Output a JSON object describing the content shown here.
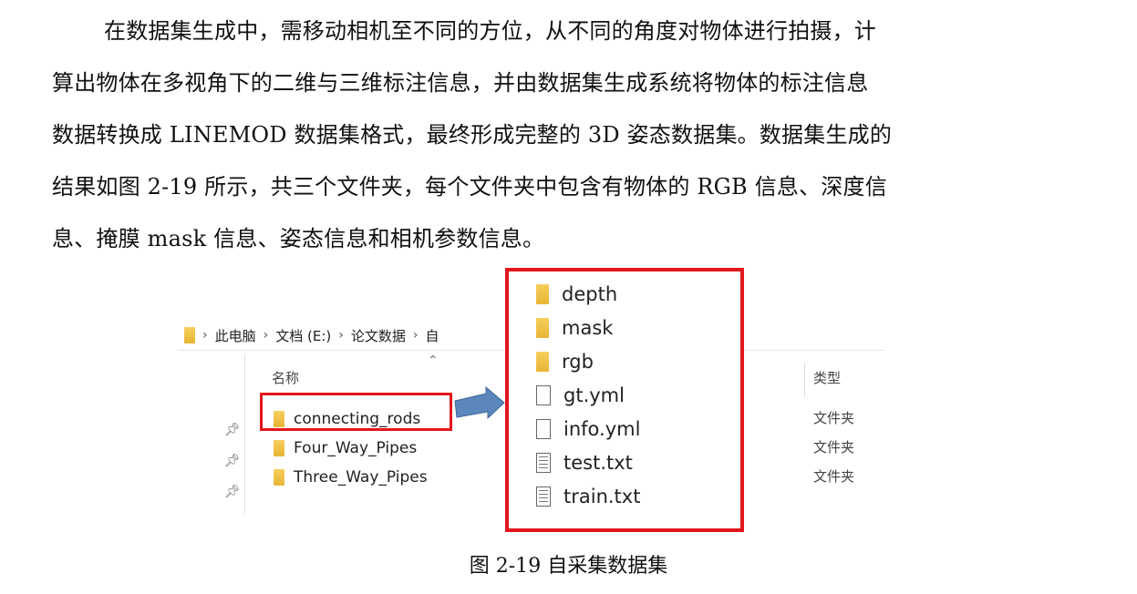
{
  "paragraph": [
    "在数据集生成中，需移动相机至不同的方位，从不同的角度对物体进行拍摄，计",
    "算出物体在多视角下的二维与三维标注信息，并由数据集生成系统将物体的标注信息",
    "数据转换成 LINEMOD 数据集格式，最终形成完整的 3D 姿态数据集。数据集生成的",
    "结果如图 2-19 所示，共三个文件夹，每个文件夹中包含有物体的 RGB 信息、深度信",
    "息、掩膜 mask 信息、姿态信息和相机参数信息。"
  ],
  "explorer": {
    "breadcrumb": [
      "此电脑",
      "文档 (E:)",
      "论文数据",
      "自"
    ],
    "column_name": "名称",
    "column_type": "类型",
    "rows": [
      {
        "name": "connecting_rods",
        "type": "文件夹"
      },
      {
        "name": "Four_Way_Pipes",
        "type": "文件夹"
      },
      {
        "name": "Three_Way_Pipes",
        "type": "文件夹"
      }
    ]
  },
  "zoomed_listing": [
    {
      "name": "depth",
      "icon": "folder-icon"
    },
    {
      "name": "mask",
      "icon": "folder-icon"
    },
    {
      "name": "rgb",
      "icon": "folder-icon"
    },
    {
      "name": "gt.yml",
      "icon": "file-icon"
    },
    {
      "name": "info.yml",
      "icon": "file-icon"
    },
    {
      "name": "test.txt",
      "icon": "text-file-icon"
    },
    {
      "name": "train.txt",
      "icon": "text-file-icon"
    }
  ],
  "caption": "图 2-19  自采集数据集",
  "colors": {
    "highlight": "#e2161c",
    "arrow": "#5b87bd",
    "folder": "#f2c64a"
  }
}
